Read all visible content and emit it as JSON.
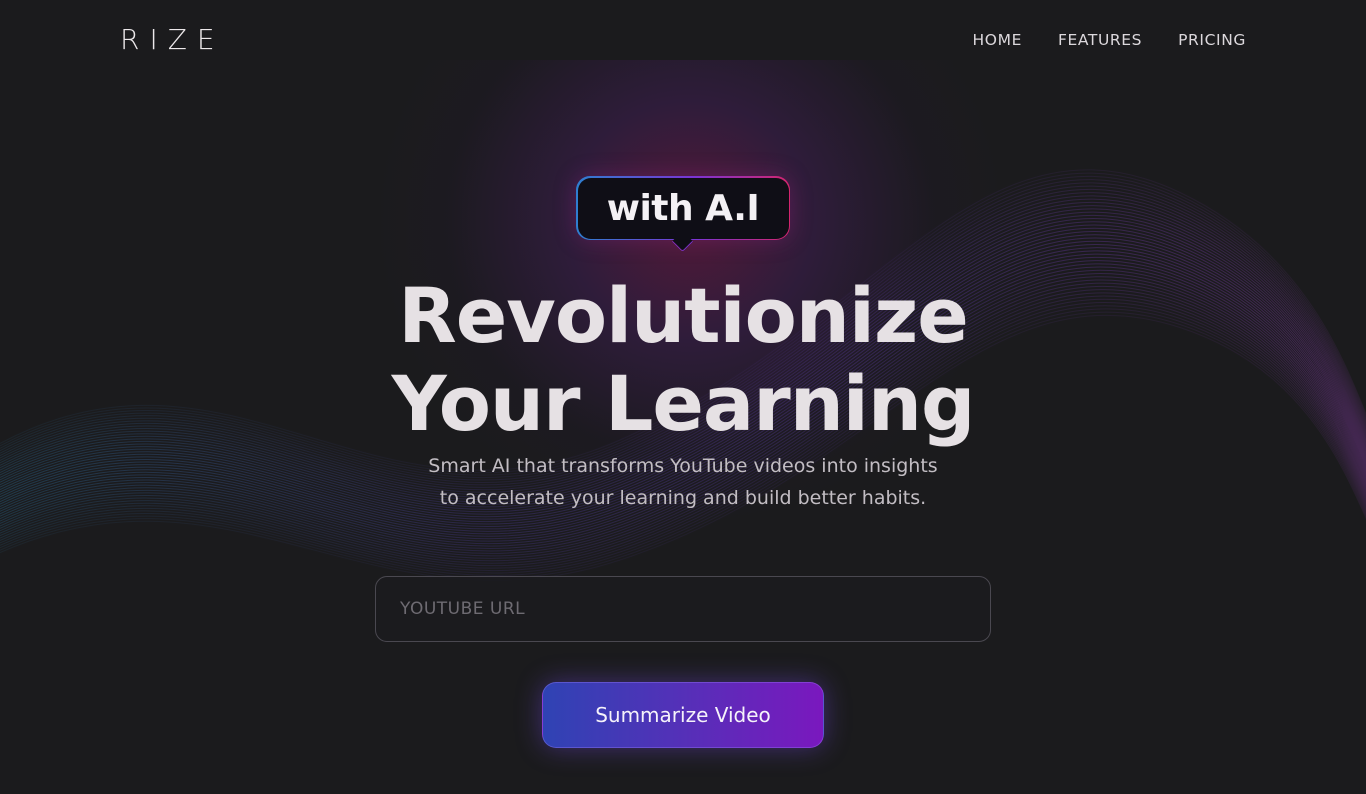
{
  "header": {
    "logo": "RIZE",
    "nav": [
      {
        "label": "HOME"
      },
      {
        "label": "FEATURES"
      },
      {
        "label": "PRICING"
      }
    ]
  },
  "hero": {
    "badge": "with A.I",
    "title_line1": "Revolutionize",
    "title_line2": "Your Learning",
    "subtitle_line1": "Smart AI that transforms YouTube videos into insights",
    "subtitle_line2": "to accelerate your learning and build better habits."
  },
  "form": {
    "url_placeholder": "YOUTUBE URL",
    "url_value": "",
    "submit_label": "Summarize Video"
  },
  "colors": {
    "background": "#1b1b1d",
    "button_gradient_start": "#2f43b4",
    "button_gradient_end": "#7a18be",
    "badge_border_start": "#2e7fd0",
    "badge_border_end": "#d4256e"
  }
}
